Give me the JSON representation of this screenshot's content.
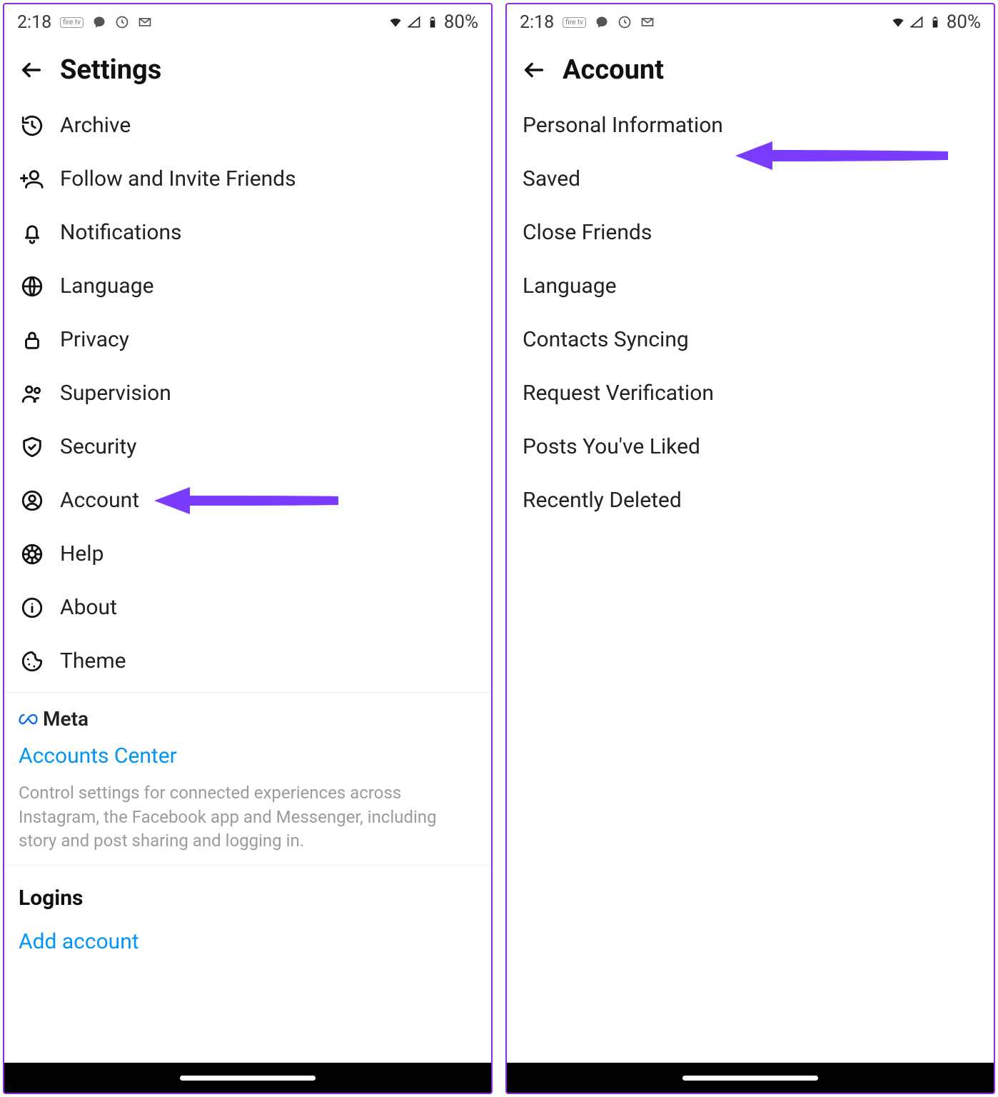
{
  "statusbar": {
    "time": "2:18",
    "tag": "fire tv",
    "battery_pct": "80%"
  },
  "left": {
    "title": "Settings",
    "items": [
      {
        "label": "Archive"
      },
      {
        "label": "Follow and Invite Friends"
      },
      {
        "label": "Notifications"
      },
      {
        "label": "Language"
      },
      {
        "label": "Privacy"
      },
      {
        "label": "Supervision"
      },
      {
        "label": "Security"
      },
      {
        "label": "Account"
      },
      {
        "label": "Help"
      },
      {
        "label": "About"
      },
      {
        "label": "Theme"
      }
    ],
    "meta_label": "Meta",
    "accounts_center": "Accounts Center",
    "meta_desc": "Control settings for connected experiences across Instagram, the Facebook app and Messenger, including story and post sharing and logging in.",
    "logins_header": "Logins",
    "add_account": "Add account"
  },
  "right": {
    "title": "Account",
    "items": [
      {
        "label": "Personal Information"
      },
      {
        "label": "Saved"
      },
      {
        "label": "Close Friends"
      },
      {
        "label": "Language"
      },
      {
        "label": "Contacts Syncing"
      },
      {
        "label": "Request Verification"
      },
      {
        "label": "Posts You've Liked"
      },
      {
        "label": "Recently Deleted"
      }
    ]
  }
}
